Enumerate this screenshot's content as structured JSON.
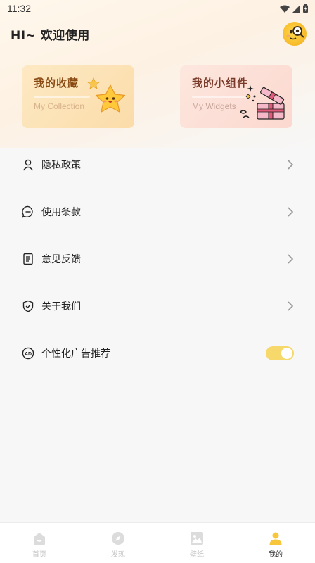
{
  "status_bar": {
    "time": "11:32"
  },
  "header": {
    "greeting": "HI~ 欢迎使用"
  },
  "cards": {
    "collection": {
      "title": "我的收藏",
      "subtitle": "My Collection"
    },
    "widgets": {
      "title": "我的小组件",
      "subtitle": "My Widgets"
    }
  },
  "menu": {
    "items": [
      {
        "label": "隐私政策",
        "icon": "person-icon"
      },
      {
        "label": "使用条款",
        "icon": "chat-icon"
      },
      {
        "label": "意见反馈",
        "icon": "document-icon"
      },
      {
        "label": "关于我们",
        "icon": "shield-icon"
      }
    ],
    "ad_toggle": {
      "label": "个性化广告推荐",
      "icon": "ad-icon",
      "enabled": true
    }
  },
  "tabbar": {
    "tabs": [
      {
        "label": "首页",
        "icon": "home-icon",
        "active": false
      },
      {
        "label": "发现",
        "icon": "compass-icon",
        "active": false
      },
      {
        "label": "壁纸",
        "icon": "image-icon",
        "active": false
      },
      {
        "label": "我的",
        "icon": "user-icon",
        "active": true
      }
    ]
  },
  "colors": {
    "accent": "#f7d86a",
    "card_collection": "#fde9c4",
    "card_widgets": "#fde7de"
  }
}
